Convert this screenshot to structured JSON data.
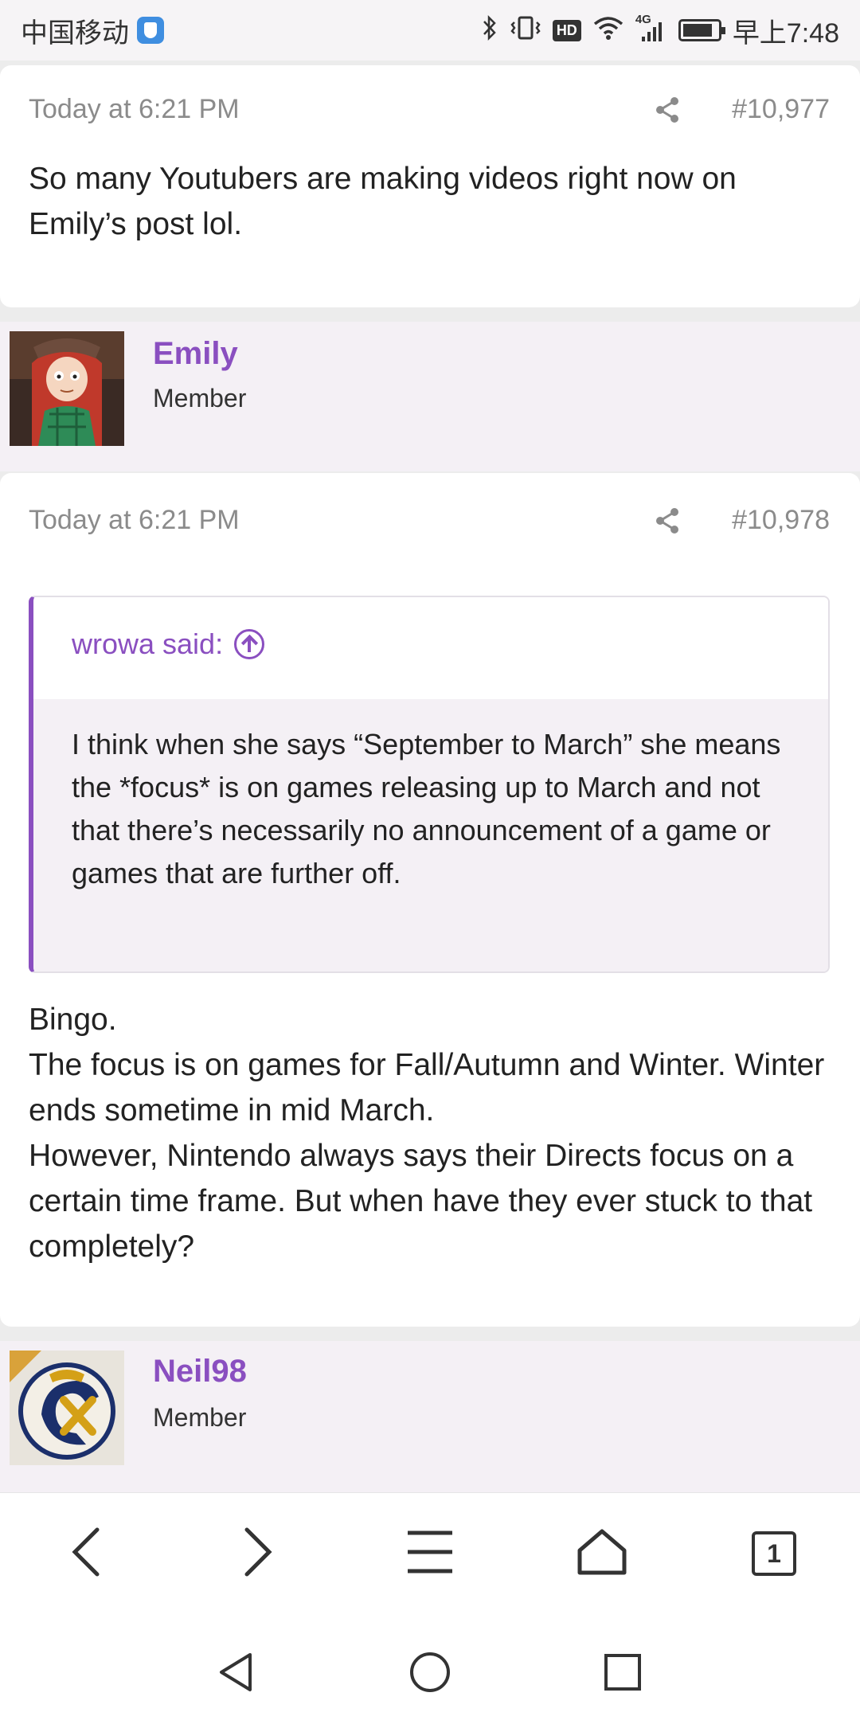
{
  "status_bar": {
    "carrier": "中国移动",
    "time": "早上7:48",
    "hd": "HD",
    "network": "4G"
  },
  "posts": [
    {
      "timestamp": "Today at 6:21 PM",
      "post_number": "#10,977",
      "body": "So many Youtubers are making videos right now on Emily’s post lol."
    },
    {
      "author": "Emily",
      "role": "Member",
      "timestamp": "Today at 6:21 PM",
      "post_number": "#10,978",
      "quote": {
        "author_label": "wrowa said:",
        "text": "I think when she says “September to March” she means the *focus* is on games releasing up to March and not that there’s necessarily no announcement of a game or games that are further off."
      },
      "body_lines": [
        "Bingo.",
        "The focus is on games for Fall/Autumn and Winter. Winter ends sometime in mid March.",
        "However, Nintendo always says their Directs focus on a certain time frame. But when have they ever stuck to that completely?"
      ]
    },
    {
      "author": "Neil98",
      "role": "Member"
    }
  ],
  "browser_bar": {
    "tab_count": "1"
  },
  "colors": {
    "accent": "#8a4fc0",
    "user_strip_bg": "#f4f0f5",
    "meta_text": "#8b8b8b"
  },
  "icons": {
    "share": "share-icon",
    "back": "chevron-left-icon",
    "forward": "chevron-right-icon",
    "menu": "hamburger-menu-icon",
    "home": "home-icon",
    "tabs": "tabs-icon"
  }
}
